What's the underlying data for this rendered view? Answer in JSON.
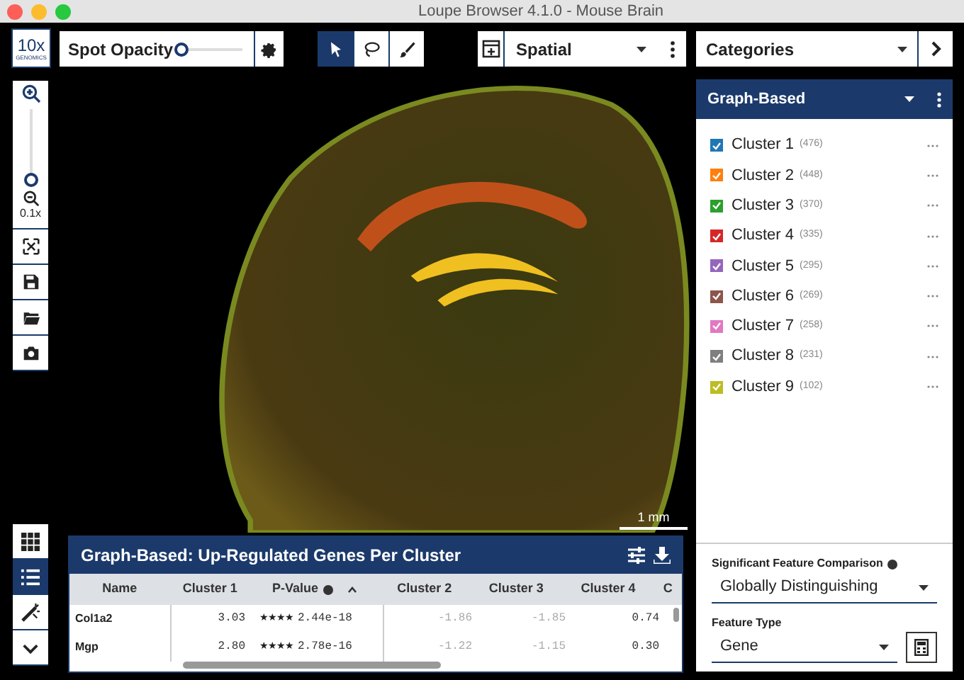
{
  "window": {
    "title": "Loupe Browser 4.1.0 - Mouse Brain"
  },
  "logo": {
    "text": "10x",
    "subtext": "GENOMICS"
  },
  "spot_opacity": {
    "label": "Spot Opacity",
    "level": 0.0
  },
  "tools": [
    {
      "kind": "pointer",
      "selected": true
    },
    {
      "kind": "lasso",
      "selected": false
    },
    {
      "kind": "brush",
      "selected": false
    }
  ],
  "view_select": {
    "value": "Spatial"
  },
  "category_select": {
    "value": "Categories"
  },
  "zoom": {
    "level": 0.0,
    "reading": "0.1x"
  },
  "scale_bar": {
    "label": "1 mm"
  },
  "left_bottom_tools": [
    {
      "kind": "grid",
      "selected": false
    },
    {
      "kind": "list",
      "selected": true
    },
    {
      "kind": "wand",
      "selected": false
    },
    {
      "kind": "chevron",
      "selected": false
    }
  ],
  "clustering": {
    "title": "Graph-Based",
    "clusters": [
      {
        "name": "Cluster 1",
        "count": "(476)",
        "color": "#1f77b4",
        "checked": true
      },
      {
        "name": "Cluster 2",
        "count": "(448)",
        "color": "#ff7f0e",
        "checked": true
      },
      {
        "name": "Cluster 3",
        "count": "(370)",
        "color": "#2ca02c",
        "checked": true
      },
      {
        "name": "Cluster 4",
        "count": "(335)",
        "color": "#d62728",
        "checked": true
      },
      {
        "name": "Cluster 5",
        "count": "(295)",
        "color": "#9467bd",
        "checked": true
      },
      {
        "name": "Cluster 6",
        "count": "(269)",
        "color": "#8c564b",
        "checked": true
      },
      {
        "name": "Cluster 7",
        "count": "(258)",
        "color": "#e377c2",
        "checked": true
      },
      {
        "name": "Cluster 8",
        "count": "(231)",
        "color": "#7f7f7f",
        "checked": true
      },
      {
        "name": "Cluster 9",
        "count": "(102)",
        "color": "#bcbd22",
        "checked": true
      }
    ]
  },
  "comparison": {
    "label": "Significant Feature Comparison",
    "value": "Globally Distinguishing"
  },
  "feature_type": {
    "label": "Feature Type",
    "value": "Gene"
  },
  "table": {
    "title": "Graph-Based: Up-Regulated Genes Per Cluster",
    "columns": [
      "Name",
      "Cluster 1",
      "P-Value",
      "Cluster 2",
      "Cluster 3",
      "Cluster 4",
      "C"
    ],
    "rows": [
      {
        "name": "Col1a2",
        "cluster_1": "3.03",
        "stars": "★★★★",
        "p_value": "2.44e-18",
        "cluster_2": "-1.86",
        "cluster_3": "-1.85",
        "cluster_4": "0.74"
      },
      {
        "name": "Mgp",
        "cluster_1": "2.80",
        "stars": "★★★★",
        "p_value": "2.78e-16",
        "cluster_2": "-1.22",
        "cluster_3": "-1.15",
        "cluster_4": "0.30"
      }
    ]
  }
}
